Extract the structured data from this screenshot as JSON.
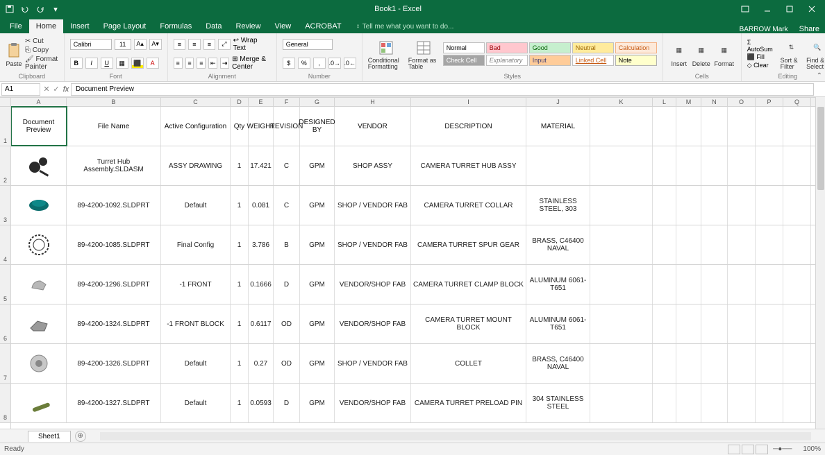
{
  "title": "Book1 - Excel",
  "user": "BARROW Mark",
  "share": "Share",
  "tabs": [
    "File",
    "Home",
    "Insert",
    "Page Layout",
    "Formulas",
    "Data",
    "Review",
    "View",
    "ACROBAT"
  ],
  "tellme": "Tell me what you want to do...",
  "activeTab": 1,
  "ribbon": {
    "clipboard": {
      "label": "Clipboard",
      "paste": "Paste",
      "cut": "Cut",
      "copy": "Copy",
      "painter": "Format Painter"
    },
    "font": {
      "label": "Font",
      "name": "Calibri",
      "size": "11"
    },
    "alignment": {
      "label": "Alignment",
      "wrap": "Wrap Text",
      "merge": "Merge & Center"
    },
    "number": {
      "label": "Number",
      "format": "General"
    },
    "styles": {
      "label": "Styles",
      "cf": "Conditional Formatting",
      "fat": "Format as Table",
      "cells": [
        {
          "t": "Normal",
          "bg": "#ffffff",
          "c": "#000"
        },
        {
          "t": "Bad",
          "bg": "#ffc7ce",
          "c": "#9c0006"
        },
        {
          "t": "Good",
          "bg": "#c6efce",
          "c": "#006100"
        },
        {
          "t": "Neutral",
          "bg": "#ffeb9c",
          "c": "#9c6500"
        },
        {
          "t": "Calculation",
          "bg": "#fde9d9",
          "c": "#c65911",
          "b": "1px solid #f4b183"
        },
        {
          "t": "Check Cell",
          "bg": "#a5a5a5",
          "c": "#fff"
        },
        {
          "t": "Explanatory",
          "bg": "#fff",
          "c": "#7f7f7f",
          "i": true
        },
        {
          "t": "Input",
          "bg": "#ffcc99",
          "c": "#3f3f76"
        },
        {
          "t": "Linked Cell",
          "bg": "#fff",
          "c": "#c65911",
          "u": true
        },
        {
          "t": "Note",
          "bg": "#ffffcc",
          "c": "#000",
          "b": "1px solid #b2b2b2"
        }
      ]
    },
    "cells": {
      "label": "Cells",
      "insert": "Insert",
      "delete": "Delete",
      "format": "Format"
    },
    "editing": {
      "label": "Editing",
      "sum": "AutoSum",
      "fill": "Fill",
      "clear": "Clear",
      "sort": "Sort & Filter",
      "find": "Find & Select"
    }
  },
  "namebox": "A1",
  "formula": "Document Preview",
  "columns": [
    "A",
    "B",
    "C",
    "D",
    "E",
    "F",
    "G",
    "H",
    "I",
    "J",
    "K",
    "L",
    "M",
    "N",
    "O",
    "P",
    "Q"
  ],
  "headers": [
    "Document Preview",
    "File Name",
    "Active Configuration",
    "Qty",
    "WEIGHT",
    "REVISION",
    "DESIGNED BY",
    "VENDOR",
    "DESCRIPTION",
    "MATERIAL"
  ],
  "rows": [
    {
      "thumb": "assy",
      "file": "Turret Hub Assembly.SLDASM",
      "cfg": "ASSY DRAWING",
      "qty": "1",
      "wt": "17.421",
      "rev": "C",
      "by": "GPM",
      "vendor": "SHOP ASSY",
      "desc": "CAMERA TURRET HUB ASSY",
      "mat": ""
    },
    {
      "thumb": "collar",
      "file": "89-4200-1092.SLDPRT",
      "cfg": "Default",
      "qty": "1",
      "wt": "0.081",
      "rev": "C",
      "by": "GPM",
      "vendor": "SHOP / VENDOR FAB",
      "desc": "CAMERA TURRET COLLAR",
      "mat": "STAINLESS STEEL, 303"
    },
    {
      "thumb": "gear",
      "file": "89-4200-1085.SLDPRT",
      "cfg": "Final Config",
      "qty": "1",
      "wt": "3.786",
      "rev": "B",
      "by": "GPM",
      "vendor": "SHOP / VENDOR FAB",
      "desc": "CAMERA TURRET SPUR GEAR",
      "mat": "BRASS, C46400 NAVAL"
    },
    {
      "thumb": "clamp",
      "file": "89-4200-1296.SLDPRT",
      "cfg": "-1 FRONT",
      "qty": "1",
      "wt": "0.1666",
      "rev": "D",
      "by": "GPM",
      "vendor": "VENDOR/SHOP FAB",
      "desc": "CAMERA TURRET CLAMP BLOCK",
      "mat": "ALUMINUM 6061-T651"
    },
    {
      "thumb": "mount",
      "file": "89-4200-1324.SLDPRT",
      "cfg": "-1 FRONT BLOCK",
      "qty": "1",
      "wt": "0.6117",
      "rev": "OD",
      "by": "GPM",
      "vendor": "VENDOR/SHOP FAB",
      "desc": "CAMERA TURRET MOUNT BLOCK",
      "mat": "ALUMINUM 6061-T651"
    },
    {
      "thumb": "collet",
      "file": "89-4200-1326.SLDPRT",
      "cfg": "Default",
      "qty": "1",
      "wt": "0.27",
      "rev": "OD",
      "by": "GPM",
      "vendor": "SHOP / VENDOR FAB",
      "desc": "COLLET",
      "mat": "BRASS, C46400 NAVAL"
    },
    {
      "thumb": "pin",
      "file": "89-4200-1327.SLDPRT",
      "cfg": "Default",
      "qty": "1",
      "wt": "0.0593",
      "rev": "D",
      "by": "GPM",
      "vendor": "VENDOR/SHOP FAB",
      "desc": "CAMERA TURRET PRELOAD PIN",
      "mat": "304 STAINLESS STEEL"
    }
  ],
  "sheet": "Sheet1",
  "status": "Ready",
  "zoom": "100%"
}
